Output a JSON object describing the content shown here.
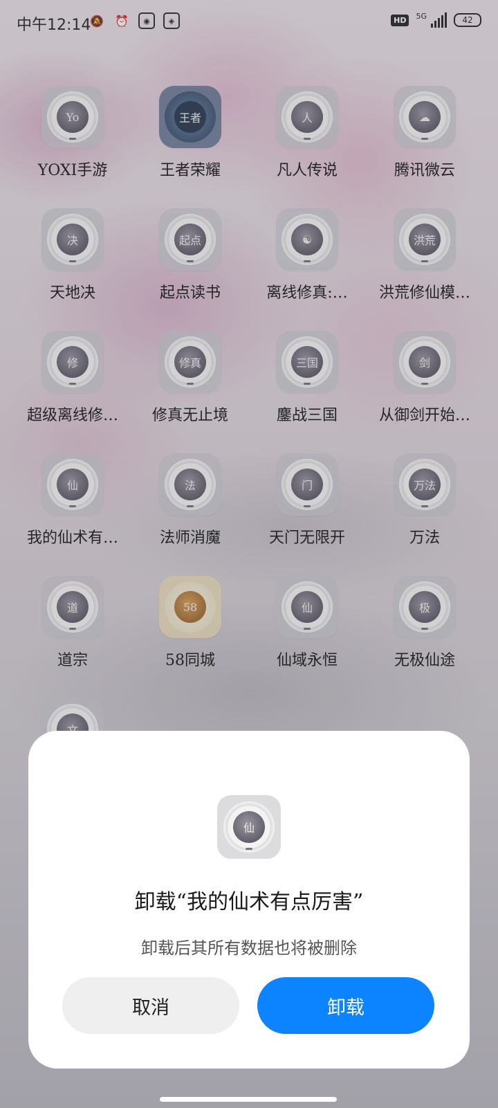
{
  "status": {
    "time": "中午12:14",
    "network": "5G",
    "hd": "HD",
    "battery": "42"
  },
  "apps": [
    {
      "label": "YOXI手游",
      "glyph": "Yo"
    },
    {
      "label": "王者荣耀",
      "glyph": "王者"
    },
    {
      "label": "凡人传说",
      "glyph": "人"
    },
    {
      "label": "腾讯微云",
      "glyph": "☁"
    },
    {
      "label": "天地决",
      "glyph": "决"
    },
    {
      "label": "起点读书",
      "glyph": "起点"
    },
    {
      "label": "离线修真:…",
      "glyph": "☯"
    },
    {
      "label": "洪荒修仙模…",
      "glyph": "洪荒"
    },
    {
      "label": "超级离线修…",
      "glyph": "修"
    },
    {
      "label": "修真无止境",
      "glyph": "修真"
    },
    {
      "label": "鏖战三国",
      "glyph": "三国"
    },
    {
      "label": "从御剑开始…",
      "glyph": "剑"
    },
    {
      "label": "我的仙术有…",
      "glyph": "仙"
    },
    {
      "label": "法师消魔",
      "glyph": "法"
    },
    {
      "label": "天门无限开",
      "glyph": "门"
    },
    {
      "label": "万法",
      "glyph": "万法"
    },
    {
      "label": "道宗",
      "glyph": "道"
    },
    {
      "label": "58同城",
      "glyph": "58"
    },
    {
      "label": "仙域永恒",
      "glyph": "仙"
    },
    {
      "label": "无极仙途",
      "glyph": "极"
    },
    {
      "label": "",
      "glyph": "文"
    }
  ],
  "dialog": {
    "title": "卸载“我的仙术有点厉害”",
    "description": "卸载后其所有数据也将被删除",
    "cancel": "取消",
    "confirm": "卸载",
    "icon_glyph": "仙"
  },
  "colors": {
    "confirm": "#0d84ff",
    "cancel_bg": "#efefef"
  }
}
